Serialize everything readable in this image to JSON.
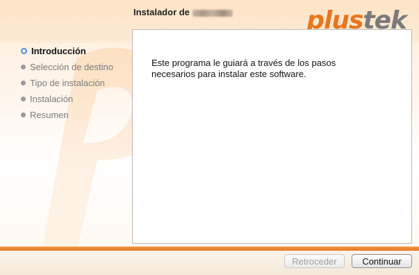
{
  "window": {
    "title_prefix": "Instalador de",
    "title_redacted": "redacted product name"
  },
  "logo": {
    "part1": "plus",
    "part2": "tek"
  },
  "steps": [
    {
      "label": "Introducción",
      "state": "active"
    },
    {
      "label": "Selección de destino",
      "state": "inactive"
    },
    {
      "label": "Tipo de instalación",
      "state": "inactive"
    },
    {
      "label": "Instalación",
      "state": "inactive"
    },
    {
      "label": "Resumen",
      "state": "inactive"
    }
  ],
  "content": {
    "text": "Este programa le guiará a través de los pasos\nnecesarios para instalar este software."
  },
  "buttons": {
    "back_label": "Retroceder",
    "back_enabled": false,
    "continue_label": "Continuar"
  },
  "colors": {
    "brand_orange": "#e8761e",
    "brand_gray": "#7a7a7a",
    "active_step_ring": "#4a8ad9"
  },
  "icons": {
    "step_marker": "bullet-dot-icon",
    "active_step_marker": "radio-ring-icon",
    "background_watermark": "plustek-p-watermark-icon"
  }
}
